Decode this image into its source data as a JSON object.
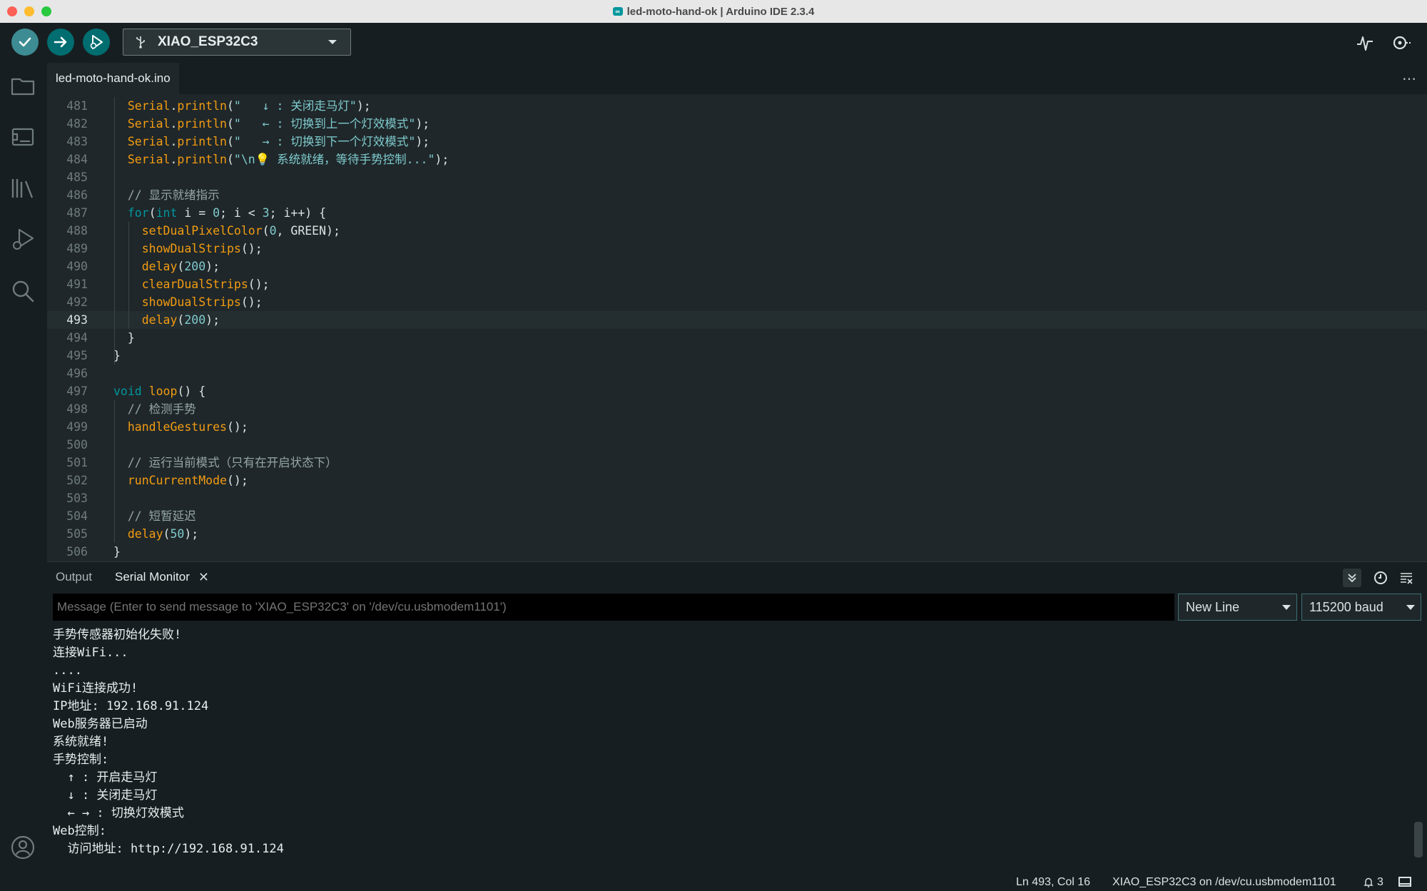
{
  "window": {
    "title": "led-moto-hand-ok | Arduino IDE 2.3.4",
    "logo_glyph": "∞"
  },
  "toolbar": {
    "board": "XIAO_ESP32C3",
    "icons": [
      "verify-icon",
      "upload-icon",
      "debug-icon",
      "usb-icon",
      "serial-plotter-icon",
      "serial-monitor-icon"
    ]
  },
  "sidebar": {
    "items": [
      "sketchbook",
      "boards-manager",
      "library-manager",
      "debug",
      "search"
    ],
    "bottom": "account"
  },
  "editor": {
    "file_tab": "led-moto-hand-ok.ino",
    "more": "⋯",
    "active_line": "493",
    "lines": [
      {
        "n": "481",
        "code": "  Serial.println(\"   ↓ : 关闭走马灯\");"
      },
      {
        "n": "482",
        "code": "  Serial.println(\"   ← : 切换到上一个灯效模式\");"
      },
      {
        "n": "483",
        "code": "  Serial.println(\"   → : 切换到下一个灯效模式\");"
      },
      {
        "n": "484",
        "code": "  Serial.println(\"\\n💡 系统就绪，等待手势控制...\");"
      },
      {
        "n": "485",
        "code": ""
      },
      {
        "n": "486",
        "code": "  // 显示就绪指示"
      },
      {
        "n": "487",
        "code": "  for(int i = 0; i < 3; i++) {"
      },
      {
        "n": "488",
        "code": "    setDualPixelColor(0, GREEN);"
      },
      {
        "n": "489",
        "code": "    showDualStrips();"
      },
      {
        "n": "490",
        "code": "    delay(200);"
      },
      {
        "n": "491",
        "code": "    clearDualStrips();"
      },
      {
        "n": "492",
        "code": "    showDualStrips();"
      },
      {
        "n": "493",
        "code": "    delay(200);"
      },
      {
        "n": "494",
        "code": "  }"
      },
      {
        "n": "495",
        "code": "}"
      },
      {
        "n": "496",
        "code": ""
      },
      {
        "n": "497",
        "code": "void loop() {"
      },
      {
        "n": "498",
        "code": "  // 检测手势"
      },
      {
        "n": "499",
        "code": "  handleGestures();"
      },
      {
        "n": "500",
        "code": ""
      },
      {
        "n": "501",
        "code": "  // 运行当前模式（只有在开启状态下）"
      },
      {
        "n": "502",
        "code": "  runCurrentMode();"
      },
      {
        "n": "503",
        "code": ""
      },
      {
        "n": "504",
        "code": "  // 短暂延迟"
      },
      {
        "n": "505",
        "code": "  delay(50);"
      },
      {
        "n": "506",
        "code": "}"
      }
    ]
  },
  "panel": {
    "tabs": {
      "output": "Output",
      "serial_monitor": "Serial Monitor",
      "close": "✕"
    },
    "message_placeholder": "Message (Enter to send message to 'XIAO_ESP32C3' on '/dev/cu.usbmodem1101')",
    "line_ending": "New Line",
    "baud": "115200 baud",
    "output_lines": [
      "手势传感器初始化失败!",
      "连接WiFi...",
      "....",
      "WiFi连接成功!",
      "IP地址: 192.168.91.124",
      "Web服务器已启动",
      "系统就绪!",
      "手势控制:",
      "  ↑ : 开启走马灯",
      "  ↓ : 关闭走马灯",
      "  ← → : 切换灯效模式",
      "Web控制:",
      "  访问地址: http://192.168.91.124"
    ]
  },
  "status": {
    "position": "Ln 493, Col 16",
    "port": "XIAO_ESP32C3 on /dev/cu.usbmodem1101",
    "notifications": "3"
  },
  "colors": {
    "accent": "#00979d",
    "bg": "#171e21",
    "editor_bg": "#1f272a",
    "keyword": "#c586c0",
    "function": "#f39c12",
    "string": "#7fcbcd",
    "number": "#7fcbcd",
    "comment": "#95a5a6",
    "type": "#00979d"
  }
}
